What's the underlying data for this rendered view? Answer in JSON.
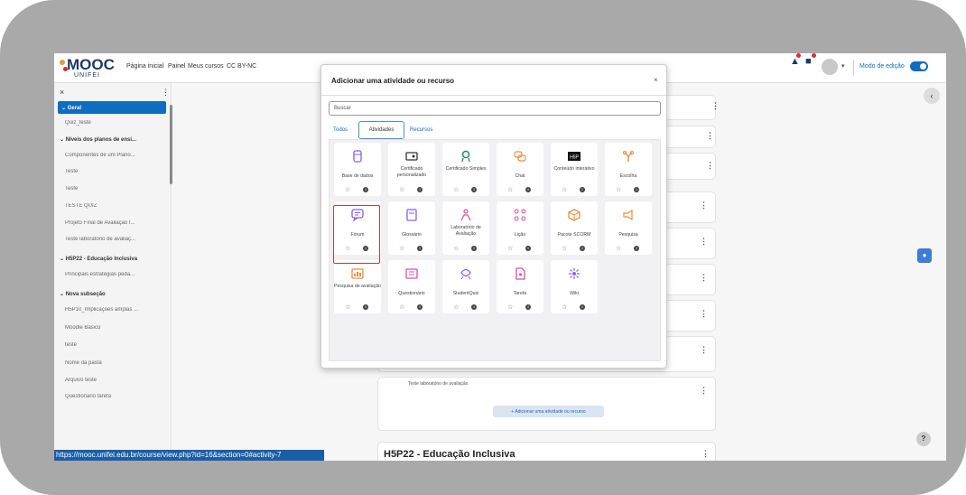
{
  "topbar": {
    "logo_text": "MOOC",
    "logo_sub": "UNIFEI",
    "nav": [
      "Página inicial",
      "Painel",
      "Meus cursos",
      "CC BY-NC"
    ],
    "edit_mode_label": "Modo de edição",
    "edit_mode_on": true
  },
  "drawer": {
    "close_glyph": "×",
    "items": [
      {
        "label": "Geral",
        "type": "active"
      },
      {
        "label": "Quiz_teste",
        "type": "item"
      },
      {
        "label": "Níveis dos planos de ensi...",
        "type": "section"
      },
      {
        "label": "Componentes de um Plano...",
        "type": "item"
      },
      {
        "label": "Teste",
        "type": "item"
      },
      {
        "label": "Teste",
        "type": "item"
      },
      {
        "label": "TESTE QUIZ",
        "type": "item"
      },
      {
        "label": "Projeto Final de Avaliação I...",
        "type": "item"
      },
      {
        "label": "Teste laboratório de avaliaç...",
        "type": "item"
      },
      {
        "label": "H5P22 - Educação Inclusiva",
        "type": "section"
      },
      {
        "label": "Principais estratégias peda...",
        "type": "item"
      },
      {
        "label": "Nova subseção",
        "type": "section"
      },
      {
        "label": "H5P10_Implicações amplas ...",
        "type": "item"
      },
      {
        "label": "Moodle Básico",
        "type": "item"
      },
      {
        "label": "teste",
        "type": "item"
      },
      {
        "label": "Nome da pasta",
        "type": "item"
      },
      {
        "label": "Arquivo teste",
        "type": "item"
      },
      {
        "label": "Questionario tarefa",
        "type": "item"
      }
    ]
  },
  "main": {
    "lab_text": "Teste laboratório de avaliação",
    "add_button": "+ Adicionar uma atividade ou recurso",
    "section_title": "H5P22 - Educação Inclusiva"
  },
  "status_url": "https://mooc.unifei.edu.br/course/view.php?id=16&section=0#activity-7",
  "modal": {
    "title": "Adicionar uma atividade ou recurso",
    "close_glyph": "×",
    "search_placeholder": "Buscar",
    "tabs": [
      "Todos",
      "Atividades",
      "Recursos"
    ],
    "active_tab": "Atividades",
    "tiles": [
      {
        "label": "Base de dados",
        "icon": "database-icon",
        "color": "#8b5cf6"
      },
      {
        "label": "Certificado personalizado",
        "icon": "certificate-icon",
        "color": "#333333"
      },
      {
        "label": "Certificado Simples",
        "icon": "badge-icon",
        "color": "#1e8a6a"
      },
      {
        "label": "Chat",
        "icon": "chat-icon",
        "color": "#f08a3c"
      },
      {
        "label": "Conteúdo interativo",
        "icon": "h5p-icon",
        "color": "#111111"
      },
      {
        "label": "Escolha",
        "icon": "choice-icon",
        "color": "#f08a3c"
      },
      {
        "label": "Fórum",
        "icon": "forum-icon",
        "color": "#8b5cf6"
      },
      {
        "label": "Glossário",
        "icon": "glossary-icon",
        "color": "#8b5cf6"
      },
      {
        "label": "Laboratório de Avaliação",
        "icon": "workshop-icon",
        "color": "#d94fa0"
      },
      {
        "label": "Lição",
        "icon": "lesson-icon",
        "color": "#d94fa0"
      },
      {
        "label": "Pacote SCORM",
        "icon": "scorm-icon",
        "color": "#f08a3c"
      },
      {
        "label": "Pesquisa",
        "icon": "feedback-icon",
        "color": "#f08a3c"
      },
      {
        "label": "Pesquisa de avaliação",
        "icon": "survey-icon",
        "color": "#f08a3c"
      },
      {
        "label": "Questionário",
        "icon": "quiz-icon",
        "color": "#d94fa0"
      },
      {
        "label": "StudentQuiz",
        "icon": "studentquiz-icon",
        "color": "#8b5cf6"
      },
      {
        "label": "Tarefa",
        "icon": "assignment-icon",
        "color": "#d94fa0"
      },
      {
        "label": "Wiki",
        "icon": "wiki-icon",
        "color": "#8b5cf6"
      }
    ],
    "star_glyph": "☆",
    "info_glyph": "i"
  },
  "help_glyph": "?",
  "collapse_glyph": "‹"
}
